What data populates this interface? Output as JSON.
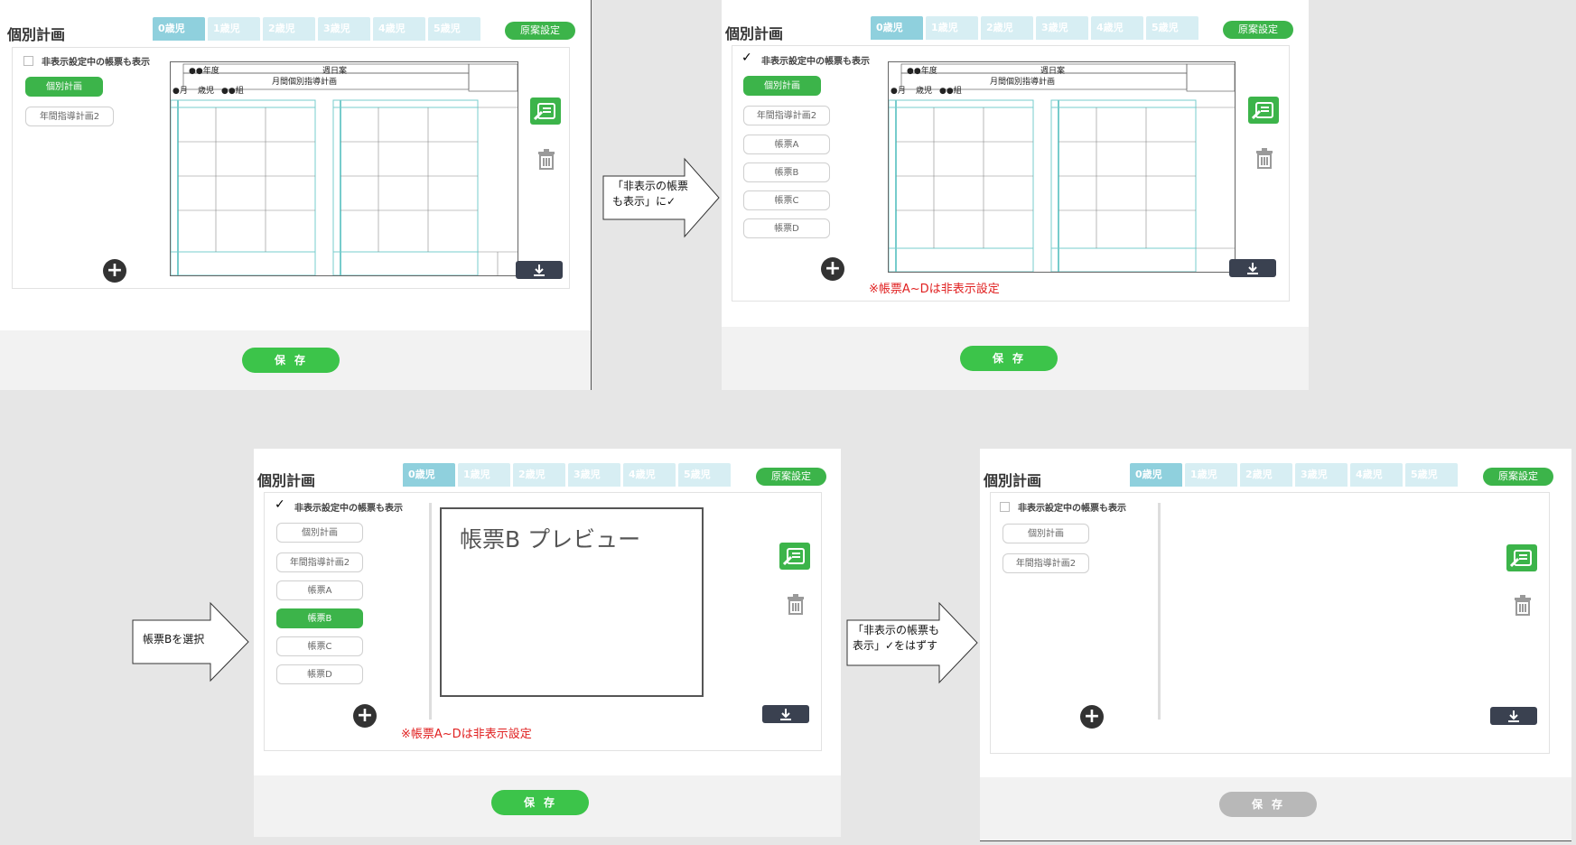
{
  "panels": [
    {
      "title": "個別計画",
      "tabs": [
        "0歳児",
        "1歳児",
        "2歳児",
        "3歳児",
        "4歳児",
        "5歳児"
      ],
      "generate_label": "原案設定",
      "show_hidden_label": "非表示設定中の帳票も表示",
      "docs": [
        "個別計画",
        "年間指導計画2"
      ],
      "save_label": "保存"
    },
    {
      "title": "個別計画",
      "tabs": [
        "0歳児",
        "1歳児",
        "2歳児",
        "3歳児",
        "4歳児",
        "5歳児"
      ],
      "generate_label": "原案設定",
      "show_hidden_label": "非表示設定中の帳票も表示",
      "docs": [
        "個別計画",
        "年間指導計画2",
        "帳票A",
        "帳票B",
        "帳票C",
        "帳票D"
      ],
      "note": "※帳票A~Dは非表示設定",
      "save_label": "保存"
    },
    {
      "title": "個別計画",
      "tabs": [
        "0歳児",
        "1歳児",
        "2歳児",
        "3歳児",
        "4歳児",
        "5歳児"
      ],
      "generate_label": "原案設定",
      "show_hidden_label": "非表示設定中の帳票も表示",
      "docs": [
        "個別計画",
        "年間指導計画2",
        "帳票A",
        "帳票B",
        "帳票C",
        "帳票D"
      ],
      "preview_text": "帳票B プレビュー",
      "note": "※帳票A~Dは非表示設定",
      "save_label": "保存"
    },
    {
      "title": "個別計画",
      "tabs": [
        "0歳児",
        "1歳児",
        "2歳児",
        "3歳児",
        "4歳児",
        "5歳児"
      ],
      "generate_label": "原案設定",
      "show_hidden_label": "非表示設定中の帳票も表示",
      "docs": [
        "個別計画",
        "年間指導計画2"
      ],
      "save_label": "保存"
    }
  ],
  "sheet": {
    "year": "●●年度",
    "weekly": "週日案",
    "monthly": "月間個別指導計画",
    "month": "●月",
    "age": "歳児",
    "name": "●●組"
  },
  "arrows": [
    {
      "line1": "「非表示の帳票",
      "line2": "も表示」に✓"
    },
    {
      "line1": "帳票Bを選択",
      "line2": ""
    },
    {
      "line1": "「非表示の帳票も",
      "line2": "表示」✓をはずす"
    }
  ],
  "colors": {
    "green": "#3cb44a",
    "tab_active": "#8fd0dd",
    "tab": "#d7eef3",
    "note": "#e02020",
    "save_disabled": "#b8b8b8"
  }
}
